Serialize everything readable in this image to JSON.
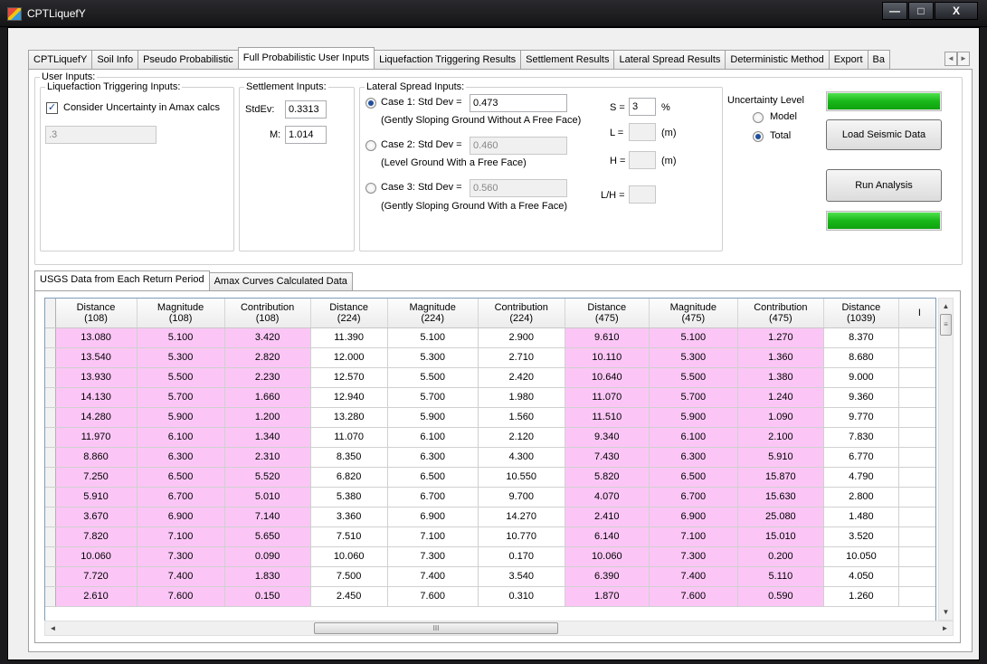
{
  "window": {
    "title": "CPTLiquefY",
    "controls": {
      "minimize": "—",
      "maximize": "□",
      "close": "X"
    }
  },
  "tabs": [
    {
      "label": "CPTLiquefY"
    },
    {
      "label": "Soil Info"
    },
    {
      "label": "Pseudo Probabilistic"
    },
    {
      "label": "Full Probabilistic User Inputs",
      "active": true
    },
    {
      "label": "Liquefaction Triggering Results"
    },
    {
      "label": "Settlement Results"
    },
    {
      "label": "Lateral Spread Results"
    },
    {
      "label": "Deterministic Method"
    },
    {
      "label": "Export"
    },
    {
      "label": "Ba"
    }
  ],
  "tab_scroll": {
    "left": "◄",
    "right": "►"
  },
  "user_inputs": {
    "title": "User Inputs:",
    "liquefaction": {
      "title": "Liquefaction Triggering Inputs:",
      "checkbox_label": "Consider Uncertainty in Amax calcs",
      "checkbox_checked": true,
      "checkbox_mark": "✓",
      "value": ".3"
    },
    "settlement": {
      "title": "Settlement Inputs:",
      "stdev_label": "StdEv:",
      "stdev_value": "0.3313",
      "m_label": "M:",
      "m_value": "1.014"
    },
    "lateral": {
      "title": "Lateral Spread Inputs:",
      "case1_label": "Case 1: Std Dev =",
      "case1_value": "0.473",
      "case1_desc": "(Gently Sloping Ground Without A Free Face)",
      "case2_label": "Case 2: Std Dev =",
      "case2_value": "0.460",
      "case2_desc": "(Level Ground With a Free Face)",
      "case3_label": "Case 3: Std Dev =",
      "case3_value": "0.560",
      "case3_desc": "(Gently Sloping Ground With a Free Face)",
      "s_label": "S =",
      "s_value": "3",
      "s_unit": "%",
      "l_label": "L =",
      "l_value": "",
      "l_unit": "(m)",
      "h_label": "H =",
      "h_value": "",
      "h_unit": "(m)",
      "lh_label": "L/H =",
      "lh_value": ""
    },
    "uncertainty": {
      "title": "Uncertainty Level",
      "model_label": "Model",
      "total_label": "Total",
      "selected": "Total"
    },
    "load_button": "Load Seismic Data",
    "run_button": "Run Analysis",
    "progress_top": 1.0,
    "progress_bottom": 1.0,
    "progress_color": "#19b719"
  },
  "subtabs": [
    {
      "label": "USGS Data from Each Return Period",
      "active": true
    },
    {
      "label": "Amax Curves Calculated Data"
    }
  ],
  "grid": {
    "highlight_color": "#fbc6f6",
    "columns": [
      {
        "name": "Distance",
        "period": "(108)",
        "pink": true
      },
      {
        "name": "Magnitude",
        "period": "(108)",
        "pink": true
      },
      {
        "name": "Contribution",
        "period": "(108)",
        "pink": true
      },
      {
        "name": "Distance",
        "period": "(224)",
        "pink": false
      },
      {
        "name": "Magnitude",
        "period": "(224)",
        "pink": false
      },
      {
        "name": "Contribution",
        "period": "(224)",
        "pink": false
      },
      {
        "name": "Distance",
        "period": "(475)",
        "pink": true
      },
      {
        "name": "Magnitude",
        "period": "(475)",
        "pink": true
      },
      {
        "name": "Contribution",
        "period": "(475)",
        "pink": true
      },
      {
        "name": "Distance",
        "period": "(1039)",
        "pink": false
      },
      {
        "name": "I",
        "period": "",
        "pink": false
      }
    ],
    "rows": [
      [
        "13.080",
        "5.100",
        "3.420",
        "11.390",
        "5.100",
        "2.900",
        "9.610",
        "5.100",
        "1.270",
        "8.370"
      ],
      [
        "13.540",
        "5.300",
        "2.820",
        "12.000",
        "5.300",
        "2.710",
        "10.110",
        "5.300",
        "1.360",
        "8.680"
      ],
      [
        "13.930",
        "5.500",
        "2.230",
        "12.570",
        "5.500",
        "2.420",
        "10.640",
        "5.500",
        "1.380",
        "9.000"
      ],
      [
        "14.130",
        "5.700",
        "1.660",
        "12.940",
        "5.700",
        "1.980",
        "11.070",
        "5.700",
        "1.240",
        "9.360"
      ],
      [
        "14.280",
        "5.900",
        "1.200",
        "13.280",
        "5.900",
        "1.560",
        "11.510",
        "5.900",
        "1.090",
        "9.770"
      ],
      [
        "11.970",
        "6.100",
        "1.340",
        "11.070",
        "6.100",
        "2.120",
        "9.340",
        "6.100",
        "2.100",
        "7.830"
      ],
      [
        "8.860",
        "6.300",
        "2.310",
        "8.350",
        "6.300",
        "4.300",
        "7.430",
        "6.300",
        "5.910",
        "6.770"
      ],
      [
        "7.250",
        "6.500",
        "5.520",
        "6.820",
        "6.500",
        "10.550",
        "5.820",
        "6.500",
        "15.870",
        "4.790"
      ],
      [
        "5.910",
        "6.700",
        "5.010",
        "5.380",
        "6.700",
        "9.700",
        "4.070",
        "6.700",
        "15.630",
        "2.800"
      ],
      [
        "3.670",
        "6.900",
        "7.140",
        "3.360",
        "6.900",
        "14.270",
        "2.410",
        "6.900",
        "25.080",
        "1.480"
      ],
      [
        "7.820",
        "7.100",
        "5.650",
        "7.510",
        "7.100",
        "10.770",
        "6.140",
        "7.100",
        "15.010",
        "3.520"
      ],
      [
        "10.060",
        "7.300",
        "0.090",
        "10.060",
        "7.300",
        "0.170",
        "10.060",
        "7.300",
        "0.200",
        "10.050"
      ],
      [
        "7.720",
        "7.400",
        "1.830",
        "7.500",
        "7.400",
        "3.540",
        "6.390",
        "7.400",
        "5.110",
        "4.050"
      ],
      [
        "2.610",
        "7.600",
        "0.150",
        "2.450",
        "7.600",
        "0.310",
        "1.870",
        "7.600",
        "0.590",
        "1.260"
      ]
    ],
    "scroll": {
      "up": "▲",
      "down": "▼",
      "left": "◄",
      "right": "►",
      "vgrip": "≡",
      "hgrip": "III"
    }
  }
}
